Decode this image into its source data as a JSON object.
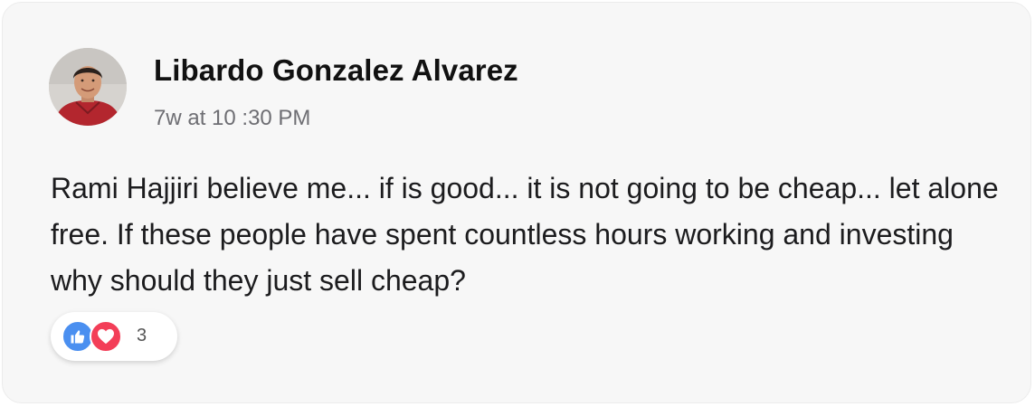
{
  "comment": {
    "author": "Libardo Gonzalez Alvarez",
    "timestamp": "7w at 10 :30 PM",
    "text": "Rami Hajjiri believe me... if is good... it is not going to be cheap... let alone free. If these people have spent countless hours working and investing why should they just sell cheap?"
  },
  "reactions": {
    "icons": [
      "like-icon",
      "love-icon"
    ],
    "count": "3",
    "colors": {
      "like": "#4a8ff0",
      "love": "#f33e58"
    }
  }
}
